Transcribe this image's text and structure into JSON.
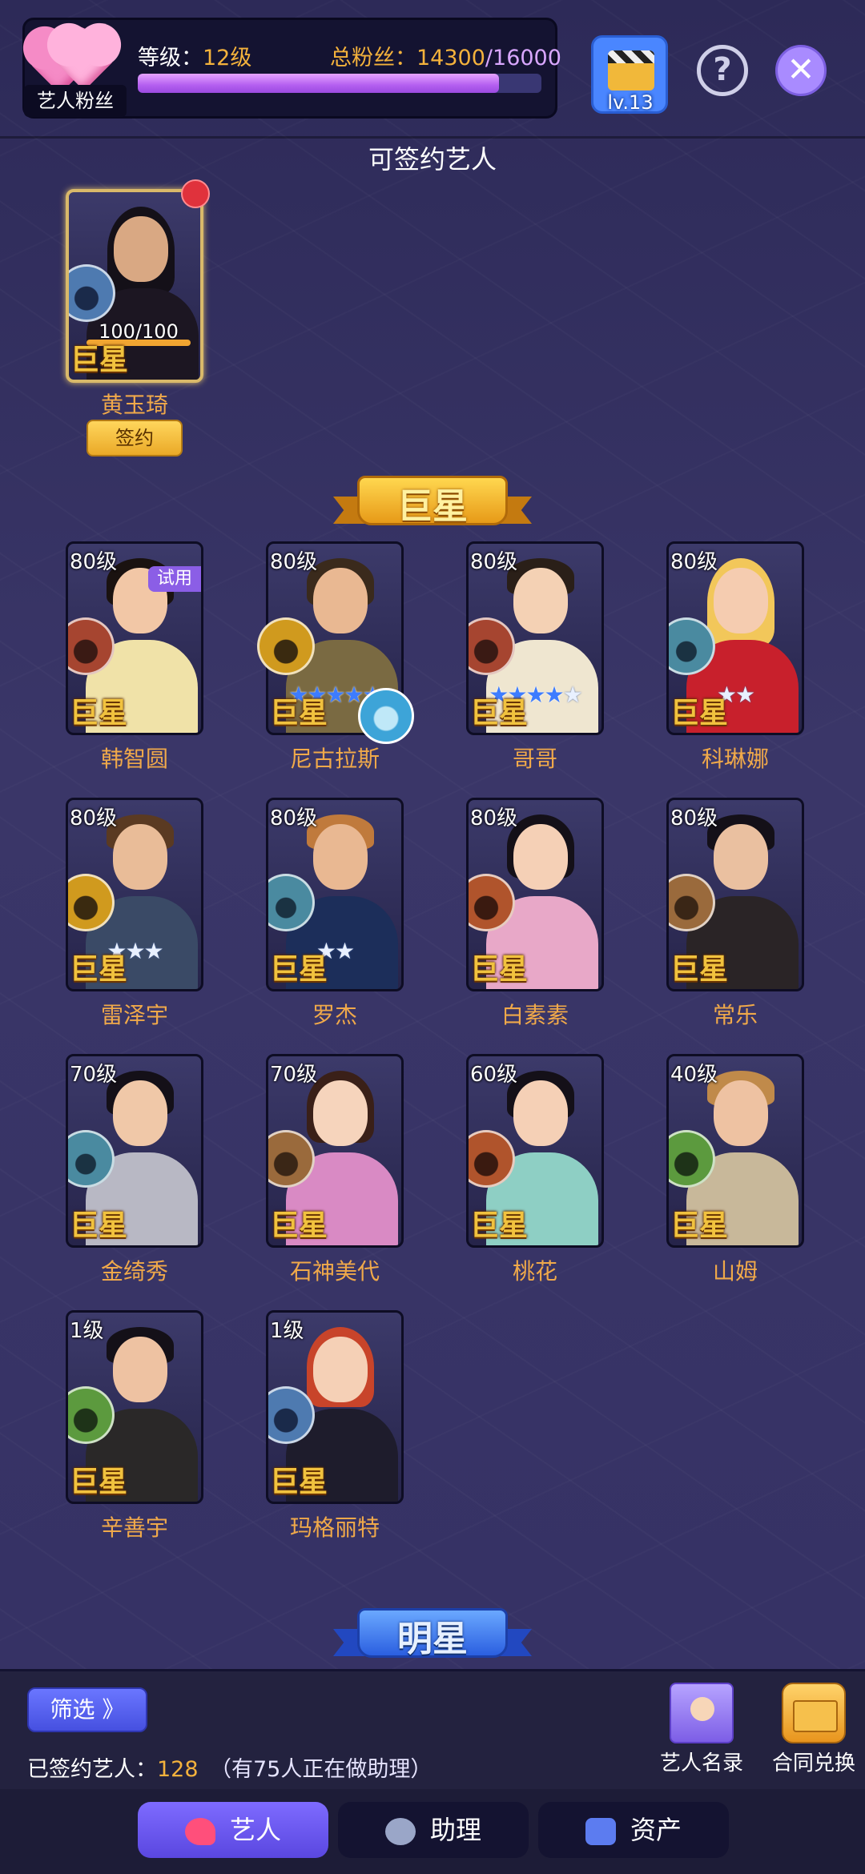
{
  "header": {
    "fan_tag": "艺人粉丝",
    "level_prefix": "等级：",
    "level_value": "12级",
    "fans_prefix": "总粉丝：",
    "fans_current": "14300",
    "fans_slash": "/",
    "fans_max": "16000",
    "fans_progress": 0.894,
    "director_level": "lv.13",
    "help_glyph": "?",
    "close_glyph": "✕"
  },
  "signable": {
    "title": "可签约艺人",
    "artist": {
      "name": "黄玉琦",
      "progress": "100/100",
      "rank": "巨星",
      "sign_label": "签约"
    }
  },
  "sections": {
    "superstar": "巨星",
    "star": "明星"
  },
  "artists": [
    {
      "name": "韩智圆",
      "level": "80级",
      "rank": "巨星",
      "badge": "试用",
      "genre": "red"
    },
    {
      "name": "尼古拉斯",
      "level": "80级",
      "rank": "巨星",
      "genre": "gold"
    },
    {
      "name": "哥哥",
      "level": "80级",
      "rank": "巨星",
      "genre": "red"
    },
    {
      "name": "科琳娜",
      "level": "80级",
      "rank": "巨星",
      "genre": "teal"
    },
    {
      "name": "雷泽宇",
      "level": "80级",
      "rank": "巨星",
      "genre": "gold"
    },
    {
      "name": "罗杰",
      "level": "80级",
      "rank": "巨星",
      "genre": "teal"
    },
    {
      "name": "白素素",
      "level": "80级",
      "rank": "巨星",
      "genre": "rust"
    },
    {
      "name": "常乐",
      "level": "80级",
      "rank": "巨星",
      "genre": "brown"
    },
    {
      "name": "金绮秀",
      "level": "70级",
      "rank": "巨星",
      "genre": "teal"
    },
    {
      "name": "石神美代",
      "level": "70级",
      "rank": "巨星",
      "genre": "brown"
    },
    {
      "name": "桃花",
      "level": "60级",
      "rank": "巨星",
      "genre": "rust"
    },
    {
      "name": "山姆",
      "level": "40级",
      "rank": "巨星",
      "genre": "green"
    },
    {
      "name": "辛善宇",
      "level": "1级",
      "rank": "巨星",
      "genre": "green"
    },
    {
      "name": "玛格丽特",
      "level": "1级",
      "rank": "巨星",
      "genre": "blue"
    }
  ],
  "bottom": {
    "filter_label": "筛选 》",
    "signed_label": "已签约艺人：",
    "signed_count": "128",
    "assist_note": "（有75人正在做助理）",
    "roster_label": "艺人名录",
    "contract_label": "合同兑换"
  },
  "tabs": [
    {
      "label": "艺人",
      "icon": "artist-icon",
      "active": true
    },
    {
      "label": "助理",
      "icon": "assistant-icon",
      "active": false
    },
    {
      "label": "资产",
      "icon": "asset-icon",
      "active": false
    }
  ],
  "colors": {
    "background": "#34305f",
    "accent_gold": "#f4b23c",
    "progress_purple": "#b45ff0",
    "tab_active": "#6a58f0"
  }
}
